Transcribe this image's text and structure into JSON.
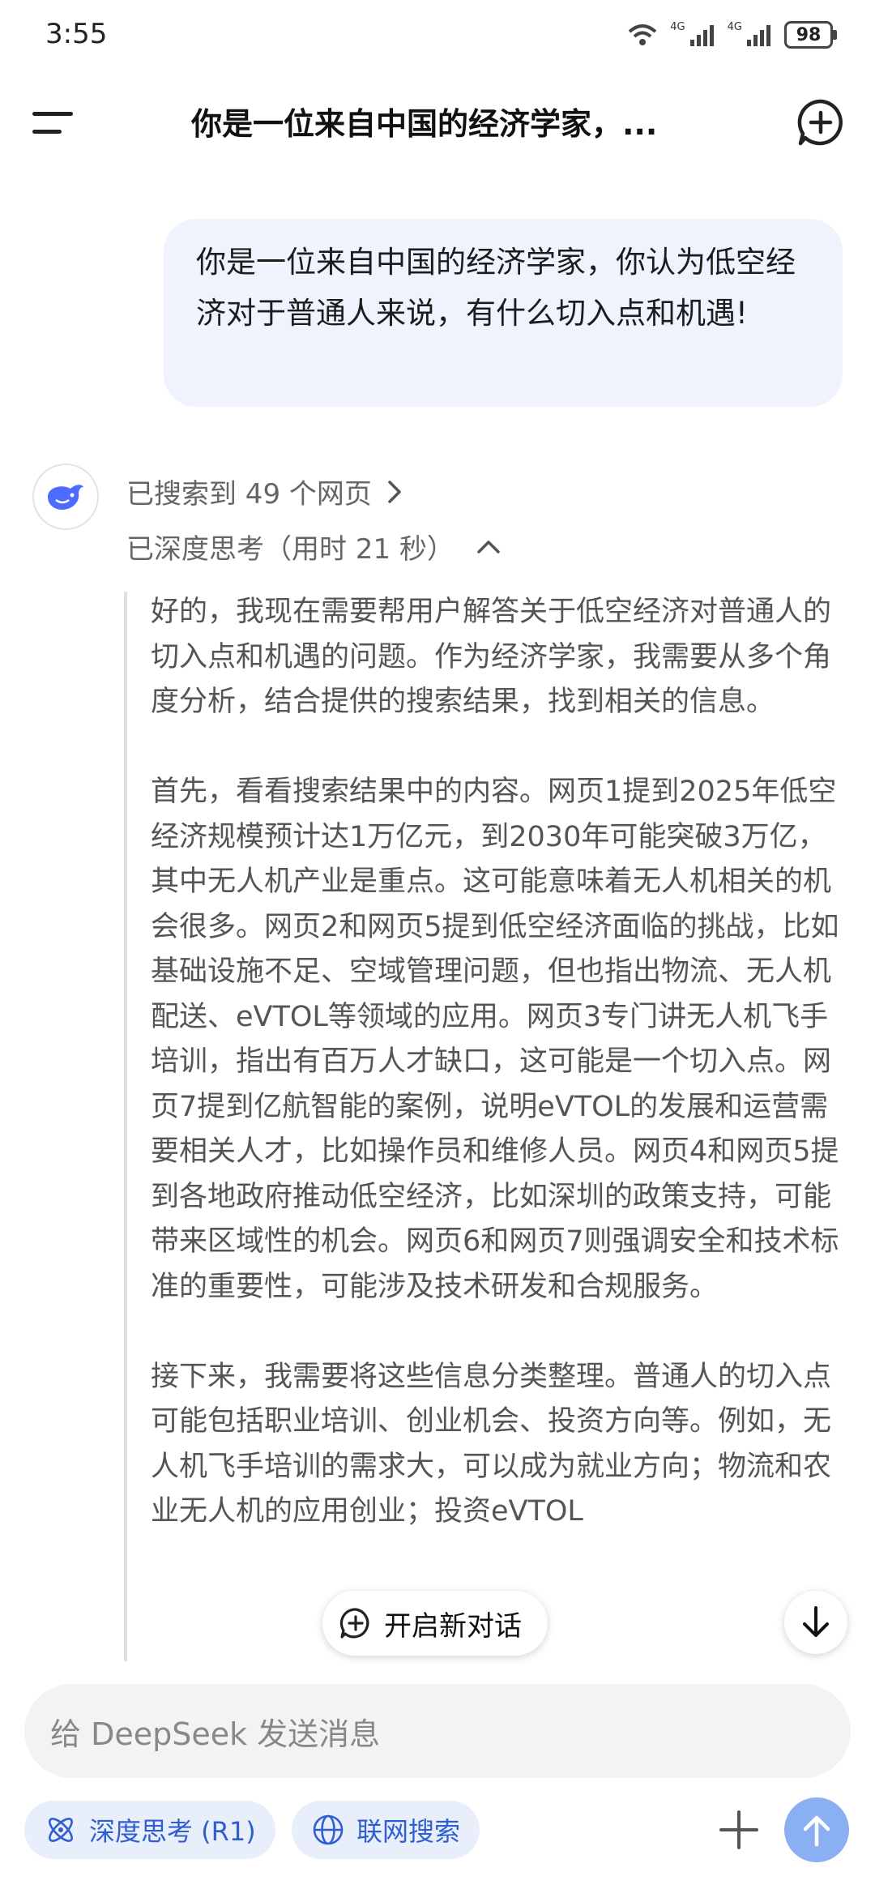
{
  "status_bar": {
    "time": "3:55",
    "network_tags": [
      "4G",
      "4G"
    ],
    "battery": "98"
  },
  "header": {
    "title": "你是一位来自中国的经济学家，..."
  },
  "user_message": {
    "text": "你是一位来自中国的经济学家，你认为低空经济对于普通人来说，有什么切入点和机遇!"
  },
  "assistant": {
    "search_status": "已搜索到 49 个网页",
    "think_status": "已深度思考（用时 21 秒）",
    "thinking_paragraphs": [
      "好的，我现在需要帮用户解答关于低空经济对普通人的切入点和机遇的问题。作为经济学家，我需要从多个角度分析，结合提供的搜索结果，找到相关的信息。",
      "首先，看看搜索结果中的内容。网页1提到2025年低空经济规模预计达1万亿元，到2030年可能突破3万亿，其中无人机产业是重点。这可能意味着无人机相关的机会很多。网页2和网页5提到低空经济面临的挑战，比如基础设施不足、空域管理问题，但也指出物流、无人机配送、eVTOL等领域的应用。网页3专门讲无人机飞手培训，指出有百万人才缺口，这可能是一个切入点。网页7提到亿航智能的案例，说明eVTOL的发展和运营需要相关人才，比如操作员和维修人员。网页4和网页5提到各地政府推动低空经济，比如深圳的政策支持，可能带来区域性的机会。网页6和网页7则强调安全和技术标准的重要性，可能涉及技术研发和合规服务。",
      "接下来，我需要将这些信息分类整理。普通人的切入点可能包括职业培训、创业机会、投资方向等。例如，无人机飞手培训的需求大，可以成为就业方向；物流和农业无人机的应用创业；投资eVTOL"
    ]
  },
  "floating": {
    "new_chat_label": "开启新对话"
  },
  "composer": {
    "placeholder": "给 DeepSeek 发送消息",
    "deep_think_label": "深度思考 (R1)",
    "web_search_label": "联网搜索"
  },
  "colors": {
    "accent": "#4d6bfe",
    "bubble_bg": "#eef3fd",
    "chip_bg": "#e9eefb",
    "send_bg": "#8ab0f3"
  }
}
